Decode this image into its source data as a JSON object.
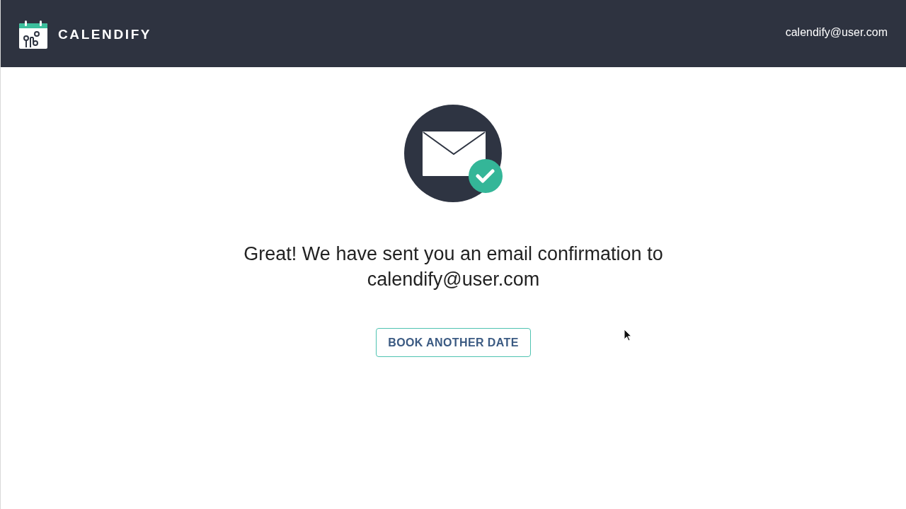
{
  "header": {
    "logo_text": "CALENDIFY",
    "user_email": "calendify@user.com"
  },
  "confirmation": {
    "message": "Great! We have sent you an email confirmation to calendify@user.com",
    "button": "BOOK ANOTHER DATE"
  }
}
